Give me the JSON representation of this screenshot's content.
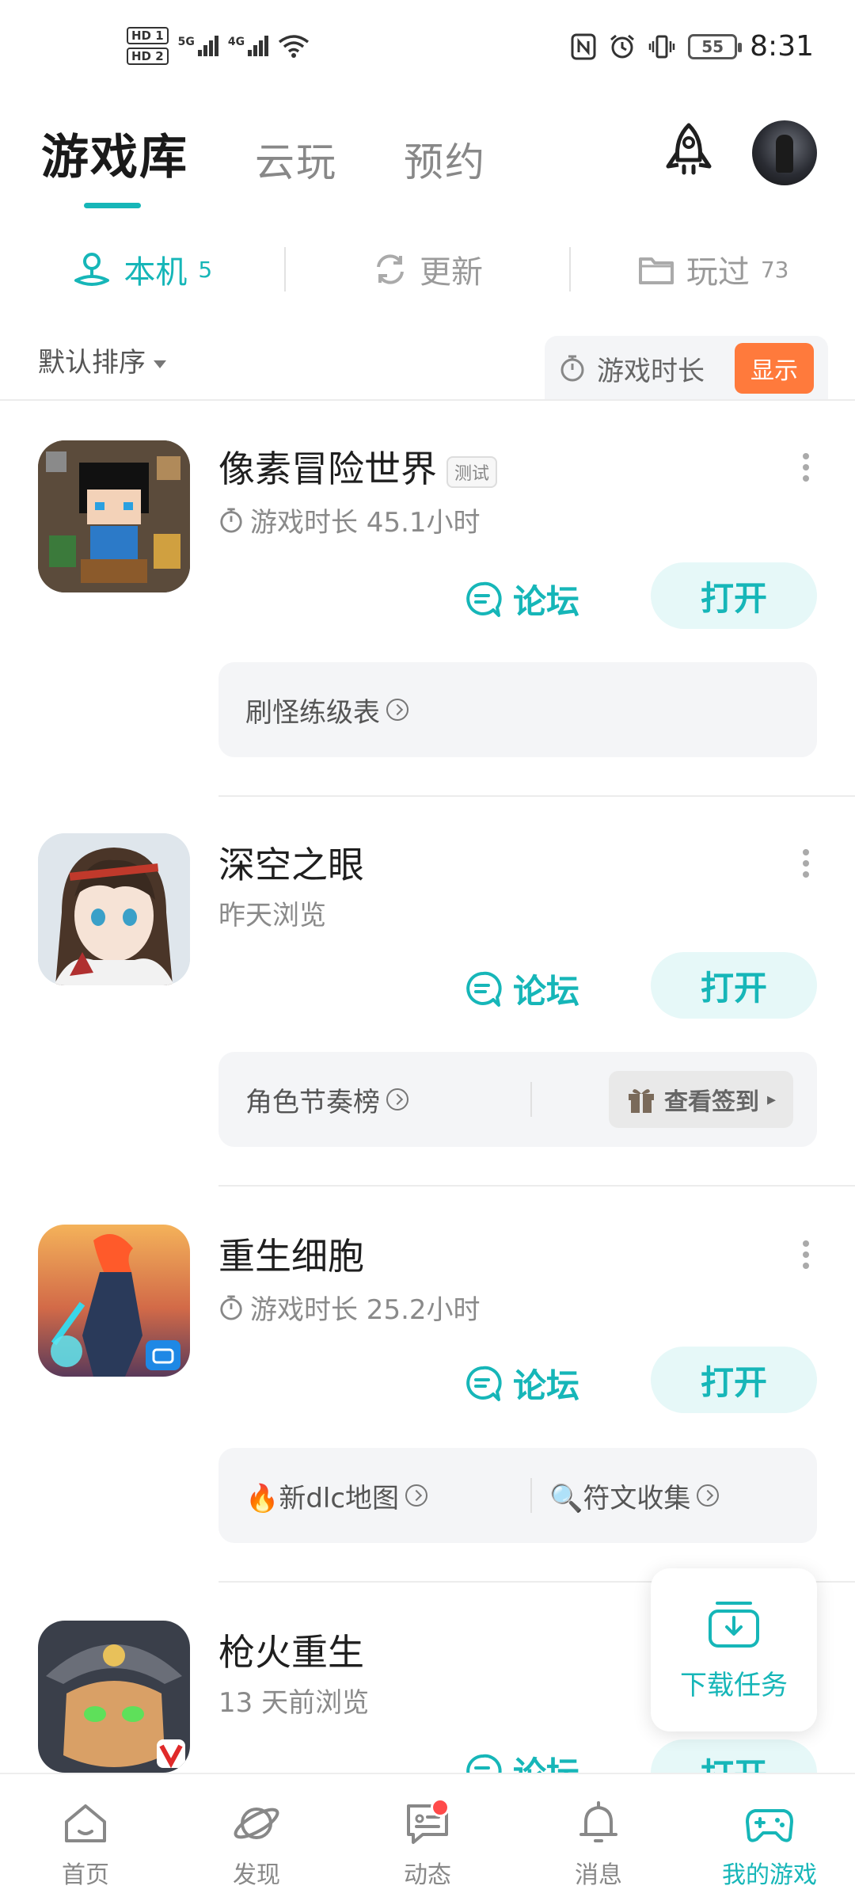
{
  "status_bar": {
    "hd1": "HD 1",
    "hd2": "HD 2",
    "sim1": "5G",
    "sim2": "4G",
    "battery": "55",
    "time": "8:31"
  },
  "top_tabs": [
    {
      "label": "游戏库",
      "active": true
    },
    {
      "label": "云玩",
      "active": false
    },
    {
      "label": "预约",
      "active": false
    }
  ],
  "sub_tabs": [
    {
      "label": "本机",
      "count": "5",
      "active": true,
      "icon": "local-device-icon"
    },
    {
      "label": "更新",
      "count": "",
      "active": false,
      "icon": "refresh-icon"
    },
    {
      "label": "玩过",
      "count": "73",
      "active": false,
      "icon": "folder-icon"
    }
  ],
  "sort": {
    "label": "默认排序"
  },
  "duration_toggle": {
    "label": "游戏时长",
    "button": "显示"
  },
  "games": [
    {
      "title": "像素冒险世界",
      "badge": "测试",
      "subtitle": "游戏时长 45.1小时",
      "forum": "论坛",
      "open": "打开",
      "card_left": "刷怪练级表"
    },
    {
      "title": "深空之眼",
      "subtitle": "昨天浏览",
      "forum": "论坛",
      "open": "打开",
      "card_left": "角色节奏榜",
      "card_button": "查看签到"
    },
    {
      "title": "重生细胞",
      "subtitle": "游戏时长 25.2小时",
      "forum": "论坛",
      "open": "打开",
      "card_left": "🔥新dlc地图",
      "card_right": "🔍符文收集"
    },
    {
      "title": "枪火重生",
      "subtitle": "13 天前浏览",
      "forum": "论坛",
      "open": "打开"
    }
  ],
  "download_task": {
    "label": "下载任务"
  },
  "bottom_nav": [
    {
      "label": "首页",
      "active": false,
      "icon": "home-icon"
    },
    {
      "label": "发现",
      "active": false,
      "icon": "planet-icon"
    },
    {
      "label": "动态",
      "active": false,
      "icon": "chat-icon",
      "badge_dot": true
    },
    {
      "label": "消息",
      "active": false,
      "icon": "bell-icon"
    },
    {
      "label": "我的游戏",
      "active": true,
      "icon": "gamepad-icon"
    }
  ],
  "colors": {
    "accent": "#16b6b8",
    "accent_light": "#e6f8f8",
    "show_button": "#ff7a3c",
    "card_bg": "#f4f5f7",
    "badge_red": "#ff4a4a"
  }
}
